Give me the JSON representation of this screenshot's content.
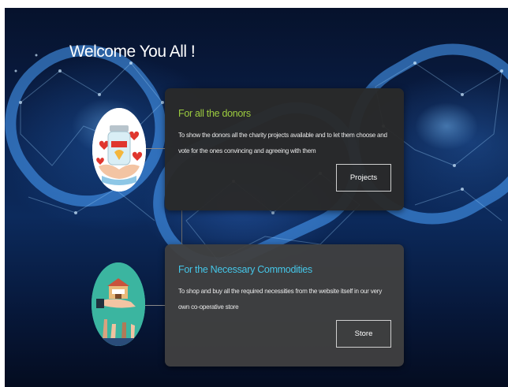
{
  "header": {
    "welcome_text": "Welcome You All !"
  },
  "cards": [
    {
      "title": "For all the donors",
      "description": "To show the donors all the charity projects available and to let them choose and vote for the ones convincing and agreeing with them",
      "button_label": "Projects"
    },
    {
      "title": "For the Necessary Commodities",
      "description": "To shop and buy all the required necessities from the website itself in our very own co-operative store",
      "button_label": "Store"
    }
  ],
  "icons": {
    "donors": "donation-jar-icon",
    "store": "cooperative-store-icon"
  },
  "colors": {
    "donors_title": "#9ccc3f",
    "store_title": "#45c6e8",
    "background": "#0a1e46"
  }
}
